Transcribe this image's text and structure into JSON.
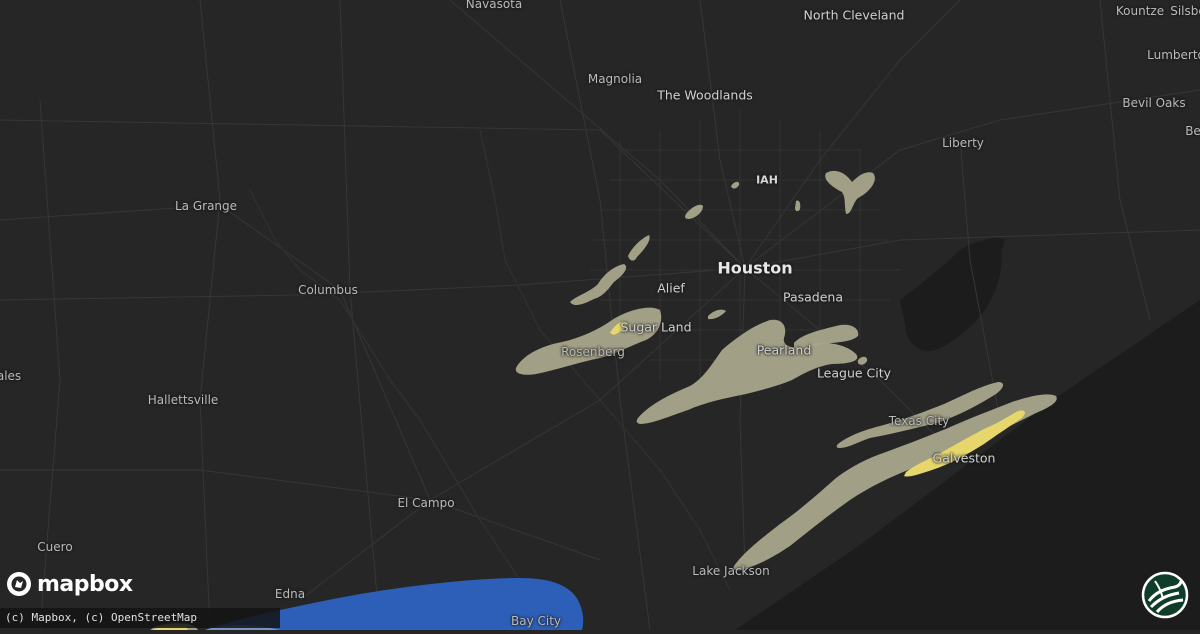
{
  "map": {
    "labels": [
      {
        "id": "navasota",
        "text": "Navasota",
        "cls": ""
      },
      {
        "id": "north-cleveland",
        "text": "North Cleveland",
        "cls": "mid"
      },
      {
        "id": "kountze",
        "text": "Kountze",
        "cls": ""
      },
      {
        "id": "lumberton",
        "text": "Lumberto",
        "cls": ""
      },
      {
        "id": "magnolia",
        "text": "Magnolia",
        "cls": ""
      },
      {
        "id": "the-woodlands",
        "text": "The Woodlands",
        "cls": "mid"
      },
      {
        "id": "bevil-oaks",
        "text": "Bevil Oaks",
        "cls": ""
      },
      {
        "id": "silsbee",
        "text": "Silsbe",
        "cls": ""
      },
      {
        "id": "be",
        "text": "Be",
        "cls": ""
      },
      {
        "id": "liberty",
        "text": "Liberty",
        "cls": ""
      },
      {
        "id": "iah",
        "text": "IAH",
        "cls": "small"
      },
      {
        "id": "la-grange",
        "text": "La Grange",
        "cls": ""
      },
      {
        "id": "houston",
        "text": "Houston",
        "cls": "major"
      },
      {
        "id": "columbus",
        "text": "Columbus",
        "cls": ""
      },
      {
        "id": "alief",
        "text": "Alief",
        "cls": "mid"
      },
      {
        "id": "pasadena",
        "text": "Pasadena",
        "cls": "mid"
      },
      {
        "id": "sugar-land",
        "text": "Sugar Land",
        "cls": "mid"
      },
      {
        "id": "rosenberg",
        "text": "Rosenberg",
        "cls": ""
      },
      {
        "id": "pearland",
        "text": "Pearland",
        "cls": "mid"
      },
      {
        "id": "league-city",
        "text": "League City",
        "cls": "mid"
      },
      {
        "id": "yoakum",
        "text": "ales",
        "cls": ""
      },
      {
        "id": "hallettsville",
        "text": "Hallettsville",
        "cls": ""
      },
      {
        "id": "texas-city",
        "text": "Texas City",
        "cls": ""
      },
      {
        "id": "galveston",
        "text": "Galveston",
        "cls": "mid"
      },
      {
        "id": "el-campo",
        "text": "El Campo",
        "cls": ""
      },
      {
        "id": "cuero",
        "text": "Cuero",
        "cls": ""
      },
      {
        "id": "lake-jackson",
        "text": "Lake Jackson",
        "cls": ""
      },
      {
        "id": "edna",
        "text": "Edna",
        "cls": ""
      },
      {
        "id": "bay-city",
        "text": "Bay City",
        "cls": ""
      }
    ],
    "hail_risk_colors": {
      "low": "#a8a58a",
      "moderate": "#e7d66c",
      "high": "#2d5fb8"
    },
    "background_color": "#262626",
    "water_color": "#1e1e1e"
  },
  "footer": {
    "attribution": "(c) Mapbox, (c) OpenStreetMap",
    "logo_text": "mapbox"
  },
  "brand": {
    "icon": "globe-logo-icon"
  }
}
